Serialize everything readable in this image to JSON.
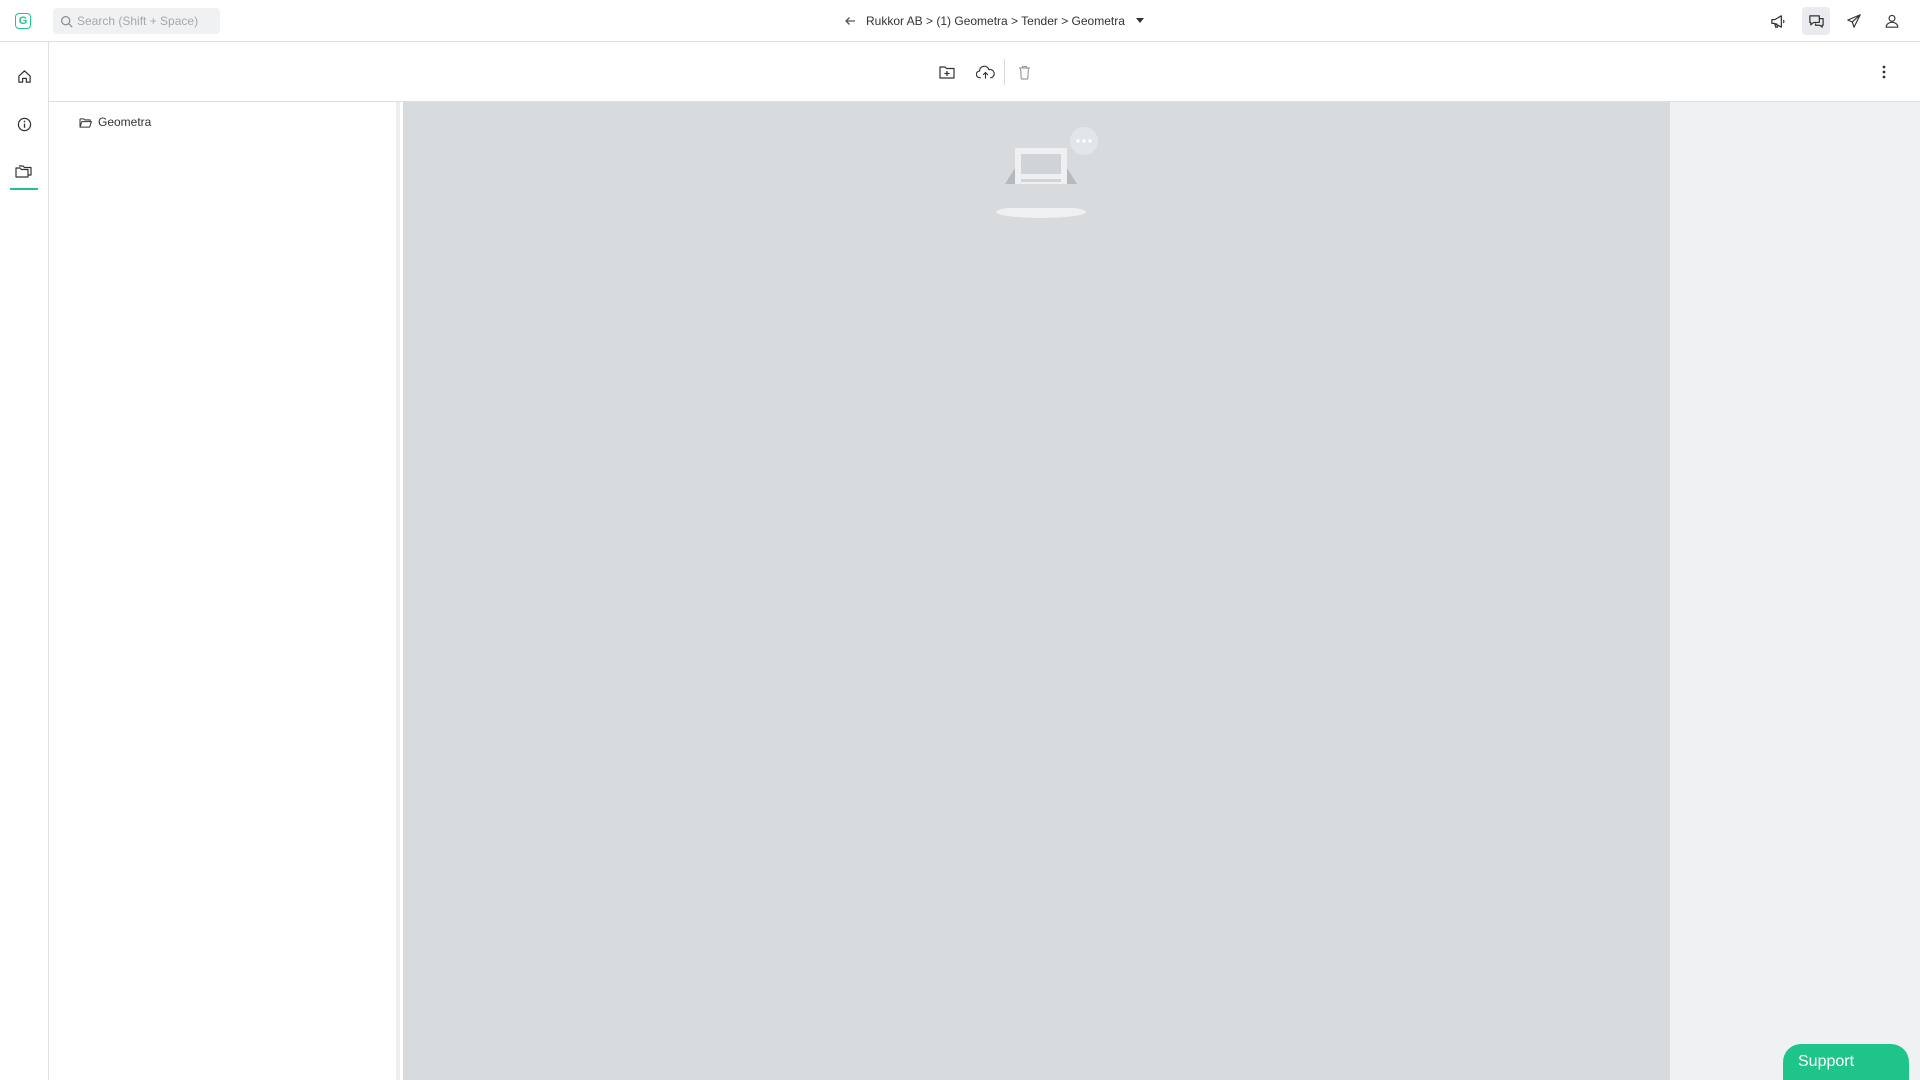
{
  "app": {
    "logo_letter": "G",
    "accent_color": "#1fc48b"
  },
  "search": {
    "placeholder": "Search (Shift + Space)"
  },
  "breadcrumb": {
    "path": "Rukkor AB > (1) Geometra > Tender > Geometra"
  },
  "top_actions": [
    {
      "icon": "megaphone-icon"
    },
    {
      "icon": "chat-icon",
      "active": true
    },
    {
      "icon": "send-icon"
    },
    {
      "icon": "user-icon"
    }
  ],
  "rail": [
    {
      "icon": "home-icon"
    },
    {
      "icon": "info-icon"
    },
    {
      "icon": "folders-icon",
      "active": true
    }
  ],
  "toolbar": [
    {
      "icon": "new-folder-icon"
    },
    {
      "icon": "cloud-upload-icon"
    },
    {
      "icon": "trash-icon",
      "disabled": true
    },
    {
      "icon": "more-vertical-icon"
    }
  ],
  "tree": {
    "items": [
      {
        "label": "Geometra",
        "icon": "folder-open-icon"
      }
    ]
  },
  "support": {
    "label": "Support"
  }
}
